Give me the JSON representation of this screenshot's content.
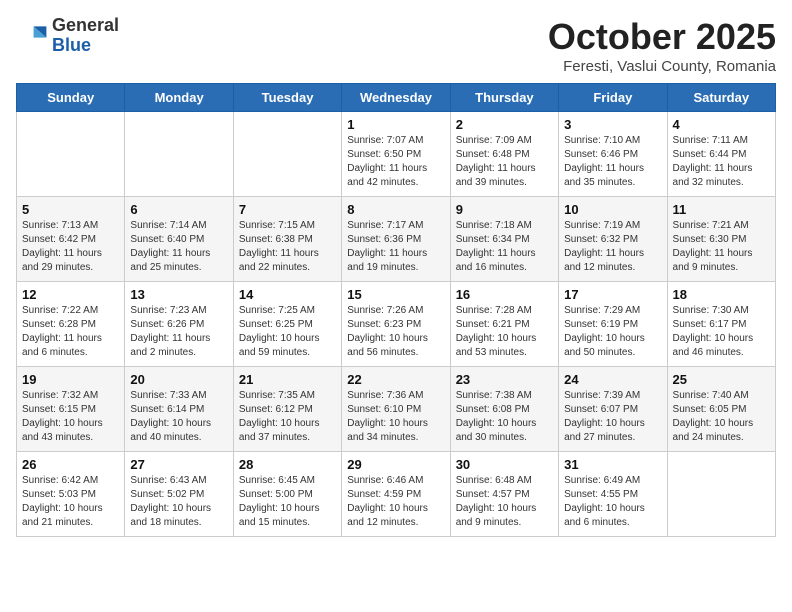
{
  "header": {
    "title": "October 2025",
    "location": "Feresti, Vaslui County, Romania",
    "logo_general": "General",
    "logo_blue": "Blue"
  },
  "weekdays": [
    "Sunday",
    "Monday",
    "Tuesday",
    "Wednesday",
    "Thursday",
    "Friday",
    "Saturday"
  ],
  "weeks": [
    [
      {
        "day": "",
        "info": ""
      },
      {
        "day": "",
        "info": ""
      },
      {
        "day": "",
        "info": ""
      },
      {
        "day": "1",
        "info": "Sunrise: 7:07 AM\nSunset: 6:50 PM\nDaylight: 11 hours\nand 42 minutes."
      },
      {
        "day": "2",
        "info": "Sunrise: 7:09 AM\nSunset: 6:48 PM\nDaylight: 11 hours\nand 39 minutes."
      },
      {
        "day": "3",
        "info": "Sunrise: 7:10 AM\nSunset: 6:46 PM\nDaylight: 11 hours\nand 35 minutes."
      },
      {
        "day": "4",
        "info": "Sunrise: 7:11 AM\nSunset: 6:44 PM\nDaylight: 11 hours\nand 32 minutes."
      }
    ],
    [
      {
        "day": "5",
        "info": "Sunrise: 7:13 AM\nSunset: 6:42 PM\nDaylight: 11 hours\nand 29 minutes."
      },
      {
        "day": "6",
        "info": "Sunrise: 7:14 AM\nSunset: 6:40 PM\nDaylight: 11 hours\nand 25 minutes."
      },
      {
        "day": "7",
        "info": "Sunrise: 7:15 AM\nSunset: 6:38 PM\nDaylight: 11 hours\nand 22 minutes."
      },
      {
        "day": "8",
        "info": "Sunrise: 7:17 AM\nSunset: 6:36 PM\nDaylight: 11 hours\nand 19 minutes."
      },
      {
        "day": "9",
        "info": "Sunrise: 7:18 AM\nSunset: 6:34 PM\nDaylight: 11 hours\nand 16 minutes."
      },
      {
        "day": "10",
        "info": "Sunrise: 7:19 AM\nSunset: 6:32 PM\nDaylight: 11 hours\nand 12 minutes."
      },
      {
        "day": "11",
        "info": "Sunrise: 7:21 AM\nSunset: 6:30 PM\nDaylight: 11 hours\nand 9 minutes."
      }
    ],
    [
      {
        "day": "12",
        "info": "Sunrise: 7:22 AM\nSunset: 6:28 PM\nDaylight: 11 hours\nand 6 minutes."
      },
      {
        "day": "13",
        "info": "Sunrise: 7:23 AM\nSunset: 6:26 PM\nDaylight: 11 hours\nand 2 minutes."
      },
      {
        "day": "14",
        "info": "Sunrise: 7:25 AM\nSunset: 6:25 PM\nDaylight: 10 hours\nand 59 minutes."
      },
      {
        "day": "15",
        "info": "Sunrise: 7:26 AM\nSunset: 6:23 PM\nDaylight: 10 hours\nand 56 minutes."
      },
      {
        "day": "16",
        "info": "Sunrise: 7:28 AM\nSunset: 6:21 PM\nDaylight: 10 hours\nand 53 minutes."
      },
      {
        "day": "17",
        "info": "Sunrise: 7:29 AM\nSunset: 6:19 PM\nDaylight: 10 hours\nand 50 minutes."
      },
      {
        "day": "18",
        "info": "Sunrise: 7:30 AM\nSunset: 6:17 PM\nDaylight: 10 hours\nand 46 minutes."
      }
    ],
    [
      {
        "day": "19",
        "info": "Sunrise: 7:32 AM\nSunset: 6:15 PM\nDaylight: 10 hours\nand 43 minutes."
      },
      {
        "day": "20",
        "info": "Sunrise: 7:33 AM\nSunset: 6:14 PM\nDaylight: 10 hours\nand 40 minutes."
      },
      {
        "day": "21",
        "info": "Sunrise: 7:35 AM\nSunset: 6:12 PM\nDaylight: 10 hours\nand 37 minutes."
      },
      {
        "day": "22",
        "info": "Sunrise: 7:36 AM\nSunset: 6:10 PM\nDaylight: 10 hours\nand 34 minutes."
      },
      {
        "day": "23",
        "info": "Sunrise: 7:38 AM\nSunset: 6:08 PM\nDaylight: 10 hours\nand 30 minutes."
      },
      {
        "day": "24",
        "info": "Sunrise: 7:39 AM\nSunset: 6:07 PM\nDaylight: 10 hours\nand 27 minutes."
      },
      {
        "day": "25",
        "info": "Sunrise: 7:40 AM\nSunset: 6:05 PM\nDaylight: 10 hours\nand 24 minutes."
      }
    ],
    [
      {
        "day": "26",
        "info": "Sunrise: 6:42 AM\nSunset: 5:03 PM\nDaylight: 10 hours\nand 21 minutes."
      },
      {
        "day": "27",
        "info": "Sunrise: 6:43 AM\nSunset: 5:02 PM\nDaylight: 10 hours\nand 18 minutes."
      },
      {
        "day": "28",
        "info": "Sunrise: 6:45 AM\nSunset: 5:00 PM\nDaylight: 10 hours\nand 15 minutes."
      },
      {
        "day": "29",
        "info": "Sunrise: 6:46 AM\nSunset: 4:59 PM\nDaylight: 10 hours\nand 12 minutes."
      },
      {
        "day": "30",
        "info": "Sunrise: 6:48 AM\nSunset: 4:57 PM\nDaylight: 10 hours\nand 9 minutes."
      },
      {
        "day": "31",
        "info": "Sunrise: 6:49 AM\nSunset: 4:55 PM\nDaylight: 10 hours\nand 6 minutes."
      },
      {
        "day": "",
        "info": ""
      }
    ]
  ]
}
